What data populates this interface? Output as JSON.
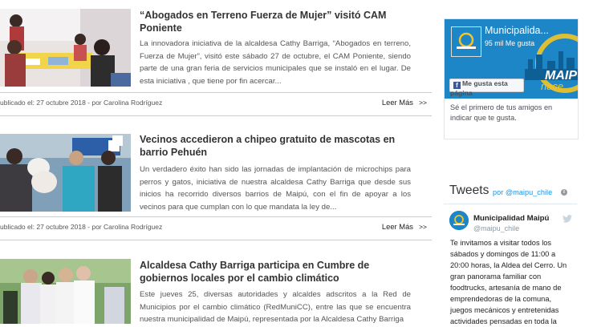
{
  "news": [
    {
      "title": "“Abogados en Terreno Fuerza de Mujer” visitó CAM Poniente",
      "body": "La innovadora iniciativa de la alcaldesa Cathy Barriga, “Abogados en terreno, Fuerza de Mujer”, visitó este sábado 27 de octubre,  el CAM Poniente, siendo parte de una gran feria de servicios municipales que se instaló en el lugar. De esta iniciativa , que tiene por fin acercar...",
      "meta": "ublicado el: 27 octubre 2018 - por Carolina Rodríguez",
      "more": "Leer Más",
      "arrows": ">>"
    },
    {
      "title": "Vecinos accedieron a chipeo gratuito de mascotas en barrio Pehuén",
      "body": "Un verdadero éxito han sido las jornadas de implantación de microchips para perros y gatos, iniciativa de nuestra alcaldesa Cathy Barriga que desde sus inicios ha recorrido diversos barrios de Maipú, con el fin de apoyar a los vecinos para que cumplan con lo que mandata la ley de...",
      "meta": "ublicado el: 27 octubre 2018 - por Carolina Rodríguez",
      "more": "Leer Más",
      "arrows": ">>"
    },
    {
      "title": "Alcaldesa Cathy Barriga participa en Cumbre de gobiernos locales por el cambio climático",
      "body": "Este jueves 25,  diversas autoridades y alcaldes adscritos a la Red de Municipios por el cambio climático (RedMuniCC), entre las que se encuentra nuestra municipalidad de Maipú, representada por la Alcaldesa Cathy Barriga"
    }
  ],
  "facebook": {
    "page_name": "Municipalida...",
    "likes": "95 mil Me gusta",
    "like_button": "Me gusta esta página",
    "friends_text": "Sé el primero de tus amigos en indicar que te gustа.",
    "logo_text": "MAIPÚ",
    "banner_text": "MAIPÚ",
    "banner_subtext": "nace",
    "brand_color": "#1d86c7"
  },
  "twitter": {
    "heading": "Tweets",
    "by": "por @maipu_chile",
    "account_name": "Municipalidad Maipú",
    "account_handle": "@maipu_chile",
    "tweet_text": "Te invitamos a visitar todos los sábados y domingos de 11:00 a 20:00 horas, la Aldea del Cerro. Un gran panorama familiar con foodtrucks, artesanía de mano de emprendedoras de la comuna, juegos mecánicos y entretenidas actividades pensadas en toda la"
  }
}
